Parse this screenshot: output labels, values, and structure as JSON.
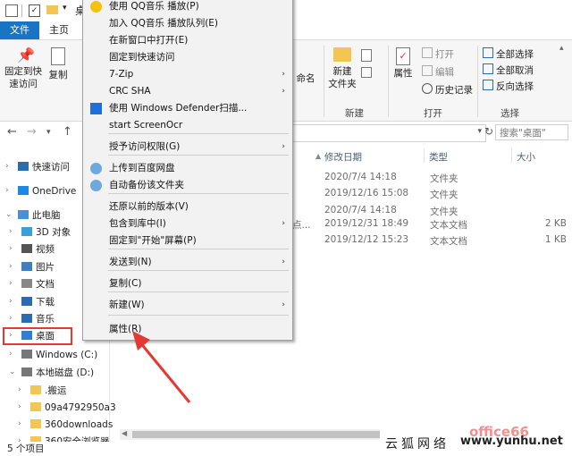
{
  "titlebar": {
    "title": "桌"
  },
  "ribbon_tabs": {
    "file": "文件",
    "home": "主页"
  },
  "ribbon": {
    "pin_quick_access": "固定到快\n速访问",
    "copy": "复制",
    "rename_partial": "命名",
    "new_folder": "新建\n文件夹",
    "new_group": "新建",
    "properties": "属性",
    "open": "打开",
    "edit": "编辑",
    "history": "历史记录",
    "open_group": "打开",
    "select_all": "全部选择",
    "select_none": "全部取消",
    "invert_selection": "反向选择",
    "select_group": "选择"
  },
  "address": {
    "search_placeholder": "搜索\"桌面\""
  },
  "navpane": {
    "items": [
      {
        "label": "快速访问",
        "icon": "star-icon"
      },
      {
        "label": "OneDrive",
        "icon": "cloud-icon"
      },
      {
        "label": "此电脑",
        "icon": "computer-icon"
      },
      {
        "label": "3D 对象",
        "icon": "cube-icon"
      },
      {
        "label": "视频",
        "icon": "video-icon"
      },
      {
        "label": "图片",
        "icon": "picture-icon"
      },
      {
        "label": "文档",
        "icon": "document-icon"
      },
      {
        "label": "下载",
        "icon": "download-icon"
      },
      {
        "label": "音乐",
        "icon": "music-icon"
      },
      {
        "label": "桌面",
        "icon": "desktop-icon"
      },
      {
        "label": "Windows (C:)",
        "icon": "drive-icon"
      },
      {
        "label": "本地磁盘 (D:)",
        "icon": "drive-icon"
      },
      {
        "label": ".搬运",
        "icon": "folder-icon"
      },
      {
        "label": "09a4792950a3",
        "icon": "folder-icon"
      },
      {
        "label": "360downloads",
        "icon": "folder-icon"
      },
      {
        "label": "360安全浏览器",
        "icon": "folder-icon"
      }
    ]
  },
  "content": {
    "columns": {
      "date": "修改日期",
      "type": "类型",
      "size": "大小"
    },
    "rows": [
      {
        "name_tail": "",
        "date": "2020/7/4 14:18",
        "type": "文件夹",
        "size": ""
      },
      {
        "name_tail": "",
        "date": "2019/12/16 15:08",
        "type": "文件夹",
        "size": ""
      },
      {
        "name_tail": "",
        "date": "2020/7/4 14:18",
        "type": "文件夹",
        "size": ""
      },
      {
        "name_tail": "点...",
        "date": "2019/12/31 18:49",
        "type": "文本文档",
        "size": "2 KB"
      },
      {
        "name_tail": "",
        "date": "2019/12/12 15:23",
        "type": "文本文档",
        "size": "1 KB"
      }
    ]
  },
  "status": {
    "count": "5 个项目"
  },
  "context_menu": {
    "items": [
      {
        "label": "使用 QQ音乐 播放(P)",
        "icon": "qqmusic-icon"
      },
      {
        "label": "加入 QQ音乐 播放队列(E)"
      },
      {
        "label": "在新窗口中打开(E)"
      },
      {
        "label": "固定到快速访问"
      },
      {
        "label": "7-Zip",
        "submenu": true
      },
      {
        "label": "CRC SHA",
        "submenu": true
      },
      {
        "label": "使用 Windows Defender扫描...",
        "icon": "defender-icon"
      },
      {
        "label": "start ScreenOcr"
      },
      {
        "label": "授予访问权限(G)",
        "submenu": true
      },
      {
        "label": "上传到百度网盘",
        "icon": "baidu-cloud-icon"
      },
      {
        "label": "自动备份该文件夹",
        "icon": "baidu-cloud-icon"
      },
      {
        "label": "还原以前的版本(V)"
      },
      {
        "label": "包含到库中(I)",
        "submenu": true
      },
      {
        "label": "固定到\"开始\"屏幕(P)"
      },
      {
        "label": "发送到(N)",
        "submenu": true
      },
      {
        "label": "复制(C)"
      },
      {
        "label": "新建(W)",
        "submenu": true
      },
      {
        "label": "属性(R)"
      }
    ]
  },
  "watermark": {
    "site_cn": "云狐网络",
    "site_url": "www.yunhu.net",
    "office_text": "office66"
  },
  "colors": {
    "accent": "#1a74c4",
    "highlight_box": "#e53935",
    "arrow": "#e53935"
  }
}
